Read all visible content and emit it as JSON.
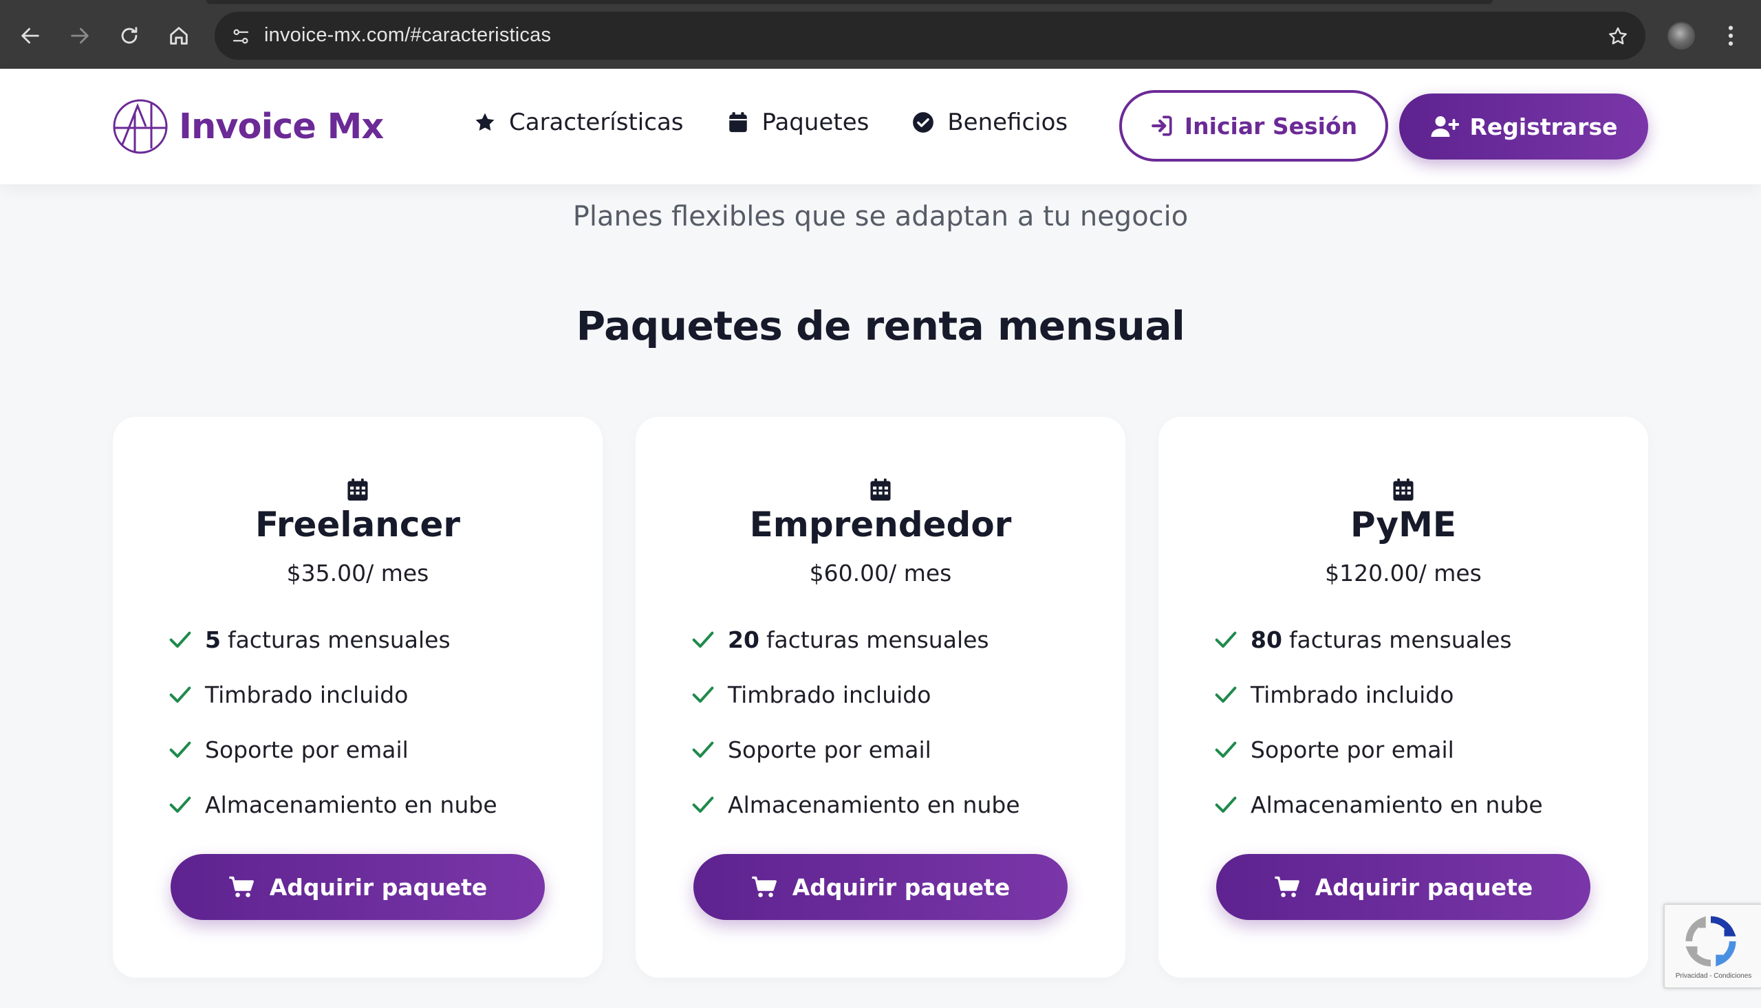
{
  "browser": {
    "url": "invoice-mx.com/#caracteristicas",
    "icons": {
      "back": "arrow-left-icon",
      "forward": "arrow-right-icon",
      "reload": "reload-icon",
      "home": "home-icon",
      "site_info": "tune-icon",
      "bookmark": "star-outline-icon",
      "menu": "kebab-menu-icon"
    }
  },
  "header": {
    "logo_text": "Invoice Mx",
    "nav": [
      {
        "label": "Características",
        "icon": "star-icon"
      },
      {
        "label": "Paquetes",
        "icon": "calendar-icon"
      },
      {
        "label": "Beneficios",
        "icon": "check-circle-icon"
      }
    ],
    "login_label": "Iniciar Sesión",
    "register_label": "Registrarse"
  },
  "content": {
    "subtitle": "Planes flexibles que se adaptan a tu negocio",
    "section_title": "Paquetes de renta mensual"
  },
  "plans": [
    {
      "name": "Freelancer",
      "price": "$35.00/ mes",
      "invoice_count": "5",
      "invoice_label": "facturas mensuales",
      "features": [
        "Timbrado incluido",
        "Soporte por email",
        "Almacenamiento en nube"
      ],
      "button": "Adquirir paquete"
    },
    {
      "name": "Emprendedor",
      "price": "$60.00/ mes",
      "invoice_count": "20",
      "invoice_label": "facturas mensuales",
      "features": [
        "Timbrado incluido",
        "Soporte por email",
        "Almacenamiento en nube"
      ],
      "button": "Adquirir paquete"
    },
    {
      "name": "PyME",
      "price": "$120.00/ mes",
      "invoice_count": "80",
      "invoice_label": "facturas mensuales",
      "features": [
        "Timbrado incluido",
        "Soporte por email",
        "Almacenamiento en nube"
      ],
      "button": "Adquirir paquete"
    }
  ],
  "recaptcha": {
    "text": "Privacidad - Condiciones"
  },
  "colors": {
    "brand": "#6b2a96",
    "check": "#1f8a4c",
    "heading": "#161a2a",
    "background": "#f6f7f9"
  }
}
